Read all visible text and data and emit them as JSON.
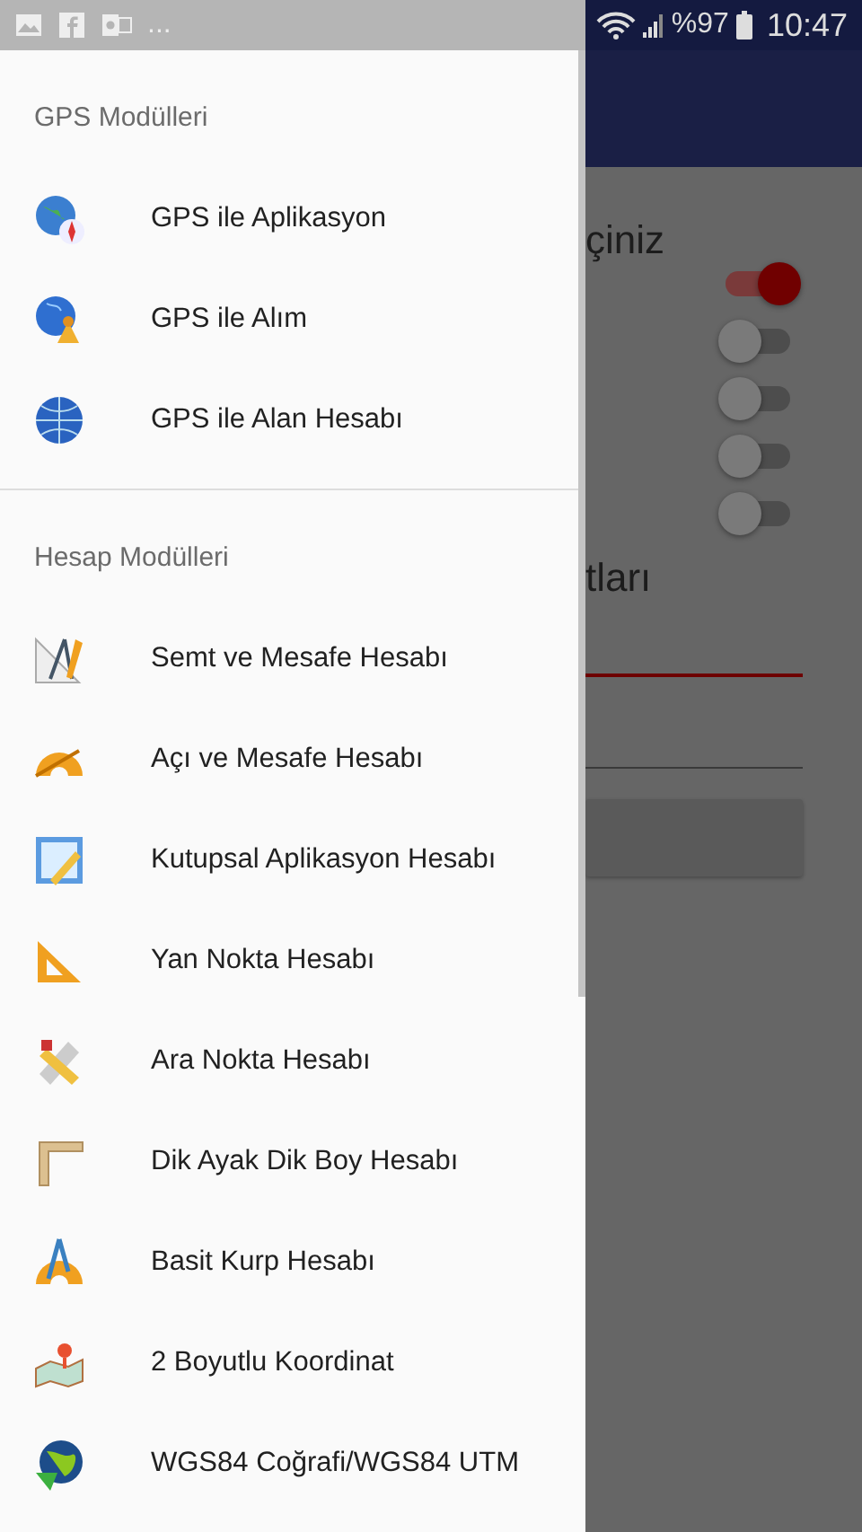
{
  "status_bar": {
    "overflow": "...",
    "battery_text": "%97",
    "time": "10:47"
  },
  "background": {
    "heading_fragment": "çiniz",
    "toggles": [
      {
        "on": true
      },
      {
        "on": false
      },
      {
        "on": false
      },
      {
        "on": false
      },
      {
        "on": false
      }
    ],
    "subheading_fragment": "tları"
  },
  "drawer": {
    "sections": [
      {
        "title": "GPS Modülleri",
        "items": [
          {
            "label": "GPS ile Aplikasyon"
          },
          {
            "label": "GPS ile Alım"
          },
          {
            "label": "GPS ile Alan Hesabı"
          }
        ]
      },
      {
        "title": "Hesap Modülleri",
        "items": [
          {
            "label": "Semt ve Mesafe Hesabı"
          },
          {
            "label": "Açı ve Mesafe Hesabı"
          },
          {
            "label": "Kutupsal Aplikasyon Hesabı"
          },
          {
            "label": "Yan Nokta Hesabı"
          },
          {
            "label": "Ara Nokta Hesabı"
          },
          {
            "label": "Dik Ayak Dik Boy Hesabı"
          },
          {
            "label": "Basit Kurp Hesabı"
          },
          {
            "label": "2 Boyutlu Koordinat"
          },
          {
            "label": "WGS84 Coğrafi/WGS84 UTM"
          }
        ]
      }
    ]
  }
}
